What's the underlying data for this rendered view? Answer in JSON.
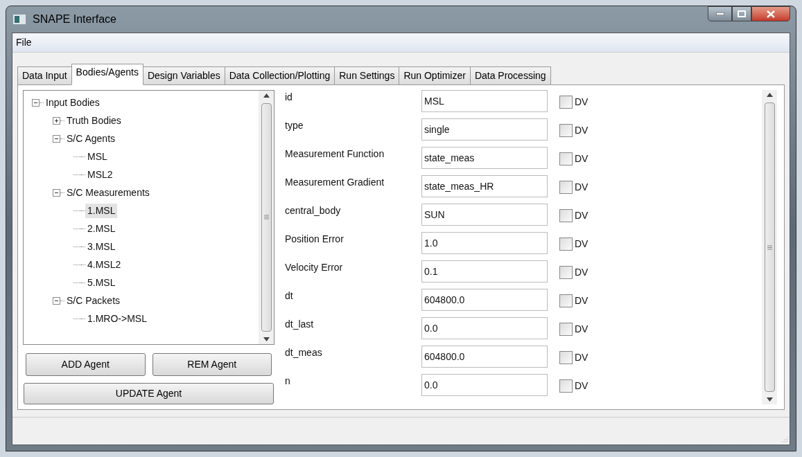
{
  "window": {
    "title": "SNAPE Interface"
  },
  "menu": [
    "File"
  ],
  "tabs": [
    {
      "label": "Data Input",
      "selected": false
    },
    {
      "label": "Bodies/Agents",
      "selected": true
    },
    {
      "label": "Design Variables",
      "selected": false
    },
    {
      "label": "Data Collection/Plotting",
      "selected": false
    },
    {
      "label": "Run Settings",
      "selected": false
    },
    {
      "label": "Run Optimizer",
      "selected": false
    },
    {
      "label": "Data Processing",
      "selected": false
    }
  ],
  "tree": [
    {
      "label": "Input Bodies",
      "expanded": true,
      "selected": false,
      "children": [
        {
          "label": "Truth Bodies",
          "expanded": false,
          "selected": false
        },
        {
          "label": "S/C Agents",
          "expanded": true,
          "selected": false,
          "children": [
            {
              "label": "MSL",
              "selected": false
            },
            {
              "label": "MSL2",
              "selected": false
            }
          ]
        },
        {
          "label": "S/C Measurements",
          "expanded": true,
          "selected": false,
          "children": [
            {
              "label": "1.MSL",
              "selected": true
            },
            {
              "label": "2.MSL",
              "selected": false
            },
            {
              "label": "3.MSL",
              "selected": false
            },
            {
              "label": "4.MSL2",
              "selected": false
            },
            {
              "label": "5.MSL",
              "selected": false
            }
          ]
        },
        {
          "label": "S/C Packets",
          "expanded": true,
          "selected": false,
          "children": [
            {
              "label": "1.MRO->MSL",
              "selected": false
            }
          ]
        }
      ]
    }
  ],
  "buttons": {
    "add": "ADD Agent",
    "remove": "REM Agent",
    "update": "UPDATE Agent"
  },
  "fields": [
    {
      "label": "id",
      "value": "MSL",
      "dv_label": "DV",
      "checked": false
    },
    {
      "label": "type",
      "value": "single",
      "dv_label": "DV",
      "checked": false
    },
    {
      "label": "Measurement Function",
      "value": "state_meas",
      "dv_label": "DV",
      "checked": false
    },
    {
      "label": "Measurement Gradient",
      "value": "state_meas_HR",
      "dv_label": "DV",
      "checked": false
    },
    {
      "label": "central_body",
      "value": "SUN",
      "dv_label": "DV",
      "checked": false
    },
    {
      "label": "Position Error",
      "value": "1.0",
      "dv_label": "DV",
      "checked": false
    },
    {
      "label": "Velocity Error",
      "value": "0.1",
      "dv_label": "DV",
      "checked": false
    },
    {
      "label": "dt",
      "value": "604800.0",
      "dv_label": "DV",
      "checked": false
    },
    {
      "label": "dt_last",
      "value": "0.0",
      "dv_label": "DV",
      "checked": false
    },
    {
      "label": "dt_meas",
      "value": "604800.0",
      "dv_label": "DV",
      "checked": false
    },
    {
      "label": "n",
      "value": "0.0",
      "dv_label": "DV",
      "checked": false
    }
  ]
}
